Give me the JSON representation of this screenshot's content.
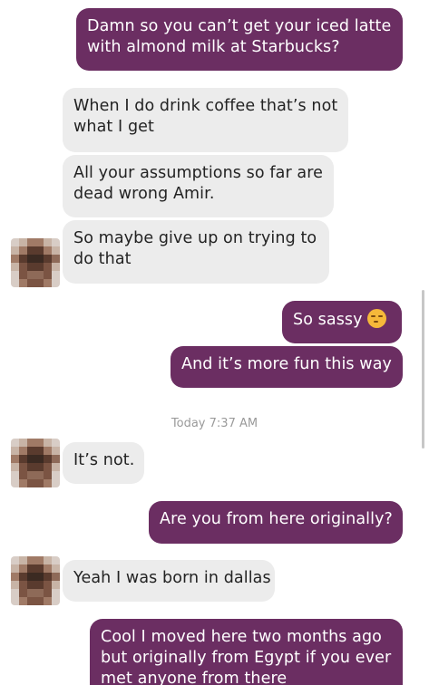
{
  "conversation": {
    "messages": [
      {
        "lines": [
          "Damn so you can’t get your iced latte",
          "with almond milk at Starbucks?"
        ]
      },
      {
        "lines": [
          "When I do drink coffee that’s not",
          "what I get"
        ]
      },
      {
        "lines": [
          "All your assumptions so far are",
          "dead wrong Amir."
        ]
      },
      {
        "lines": [
          "So maybe give up on trying to",
          "do that"
        ]
      },
      {
        "lines": [
          "So sassy"
        ],
        "emoji": "smirking-face-emoji"
      },
      {
        "lines": [
          "And it’s more fun this way"
        ]
      },
      {
        "lines": [
          "It’s not."
        ]
      },
      {
        "lines": [
          "Are you from here originally?"
        ]
      },
      {
        "lines": [
          "Yeah I was born in dallas"
        ]
      },
      {
        "lines": [
          "Cool I moved here two months ago",
          "but originally from Egypt if you ever",
          "met anyone from there"
        ]
      }
    ],
    "timestamp": {
      "day": "Today",
      "time": "7:37 AM"
    }
  },
  "theme": {
    "outgoing_bubble": "#6b2e62",
    "incoming_bubble": "#ececec",
    "avatar_palette": [
      "#5a3b2e",
      "#7b5443",
      "#a07a66",
      "#c8b4a6",
      "#3b2a22",
      "#8e6a58",
      "#d8cdc6"
    ]
  }
}
